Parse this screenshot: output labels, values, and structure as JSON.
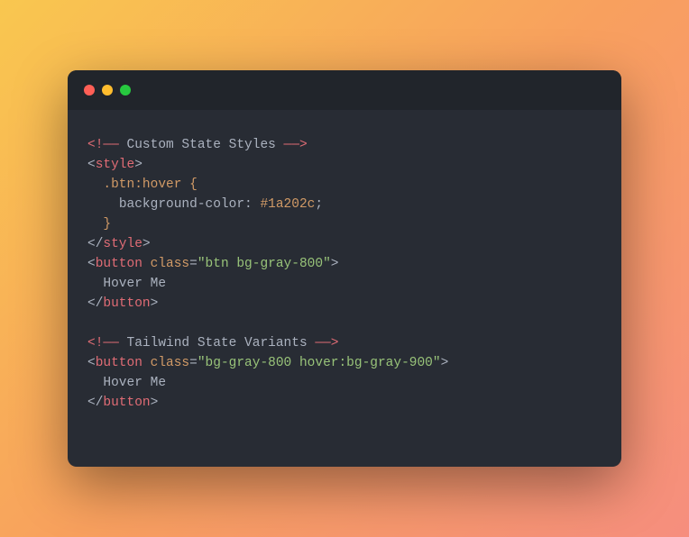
{
  "code": {
    "comment1_open": "<!——",
    "comment1_text": " Custom State Styles ",
    "comment1_close": "——>",
    "style_open_l": "<",
    "style_open_tag": "style",
    "style_open_r": ">",
    "css_selector": "  .btn:hover {",
    "css_prop_indent": "    ",
    "css_prop_name": "background-color",
    "css_prop_colon": ": ",
    "css_prop_value": "#1a202c",
    "css_prop_semi": ";",
    "css_close": "  }",
    "style_close_l": "</",
    "style_close_tag": "style",
    "style_close_r": ">",
    "btn1_open_l": "<",
    "btn1_tag": "button",
    "btn1_space": " ",
    "btn1_attr": "class",
    "btn1_eq": "=",
    "btn1_q1": "\"",
    "btn1_val": "btn bg-gray-800",
    "btn1_q2": "\"",
    "btn1_open_r": ">",
    "btn1_text": "  Hover Me",
    "btn1_close_l": "</",
    "btn1_close_tag": "button",
    "btn1_close_r": ">",
    "blank": "",
    "comment2_open": "<!——",
    "comment2_text": " Tailwind State Variants ",
    "comment2_close": "——>",
    "btn2_open_l": "<",
    "btn2_tag": "button",
    "btn2_space": " ",
    "btn2_attr": "class",
    "btn2_eq": "=",
    "btn2_q1": "\"",
    "btn2_val": "bg-gray-800 hover:bg-gray-900",
    "btn2_q2": "\"",
    "btn2_open_r": ">",
    "btn2_text": "  Hover Me",
    "btn2_close_l": "</",
    "btn2_close_tag": "button",
    "btn2_close_r": ">"
  }
}
